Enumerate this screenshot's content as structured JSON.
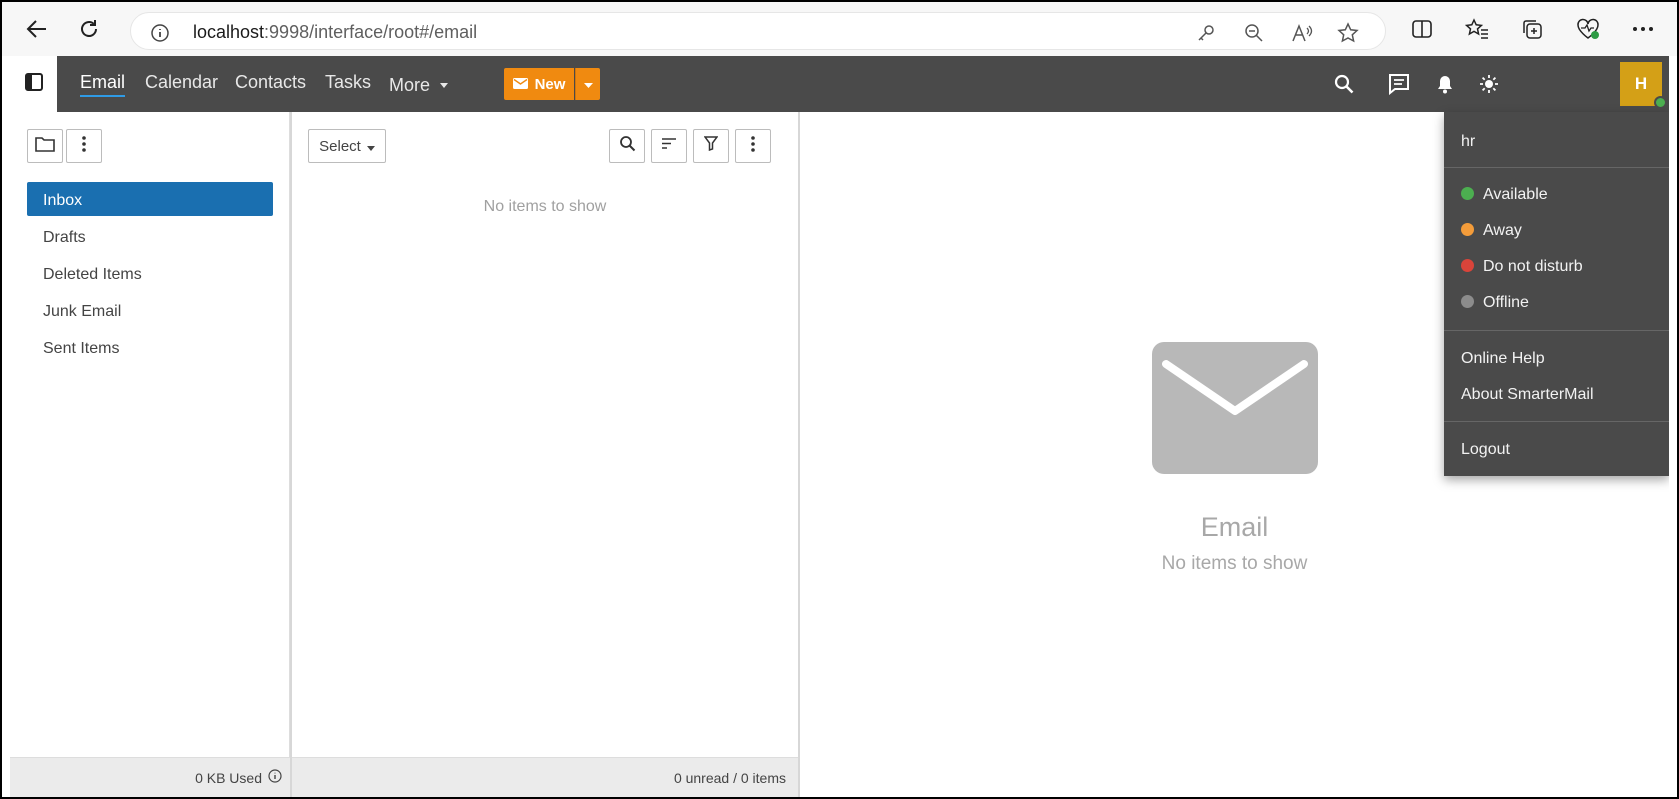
{
  "browser": {
    "url_host": "localhost",
    "url_path": ":9998/interface/root#/email",
    "icons": [
      "back-icon",
      "reload-icon",
      "info-icon",
      "key-icon",
      "zoom-out-icon",
      "read-aloud-icon",
      "favorite-star-icon",
      "split-screen-icon",
      "favorites-icon",
      "collections-icon",
      "browser-essentials-icon",
      "more-icon"
    ]
  },
  "nav": {
    "items": [
      {
        "label": "Email"
      },
      {
        "label": "Calendar"
      },
      {
        "label": "Contacts"
      },
      {
        "label": "Tasks"
      },
      {
        "label": "More"
      }
    ],
    "new_label": "New",
    "avatar_letter": "H",
    "colors": {
      "bar": "#4a4a4a",
      "new_button": "#f08a10",
      "avatar": "#d4a017",
      "active_underline": "#2f9be6"
    }
  },
  "folders": {
    "items": [
      {
        "label": "Inbox"
      },
      {
        "label": "Drafts"
      },
      {
        "label": "Deleted Items"
      },
      {
        "label": "Junk Email"
      },
      {
        "label": "Sent Items"
      }
    ],
    "active_color": "#1a6fb0",
    "footer": "0 KB Used"
  },
  "list": {
    "select_label": "Select",
    "empty_text": "No items to show",
    "footer": "0 unread / 0 items"
  },
  "reading": {
    "title": "Email",
    "subtitle": "No items to show"
  },
  "user_menu": {
    "username": "hr",
    "statuses": [
      {
        "label": "Available",
        "color": "#4caf50"
      },
      {
        "label": "Away",
        "color": "#f39c3a"
      },
      {
        "label": "Do not disturb",
        "color": "#d9443a"
      },
      {
        "label": "Offline",
        "color": "#8c8c8c"
      }
    ],
    "online_help": "Online Help",
    "about": "About SmarterMail",
    "logout": "Logout"
  }
}
